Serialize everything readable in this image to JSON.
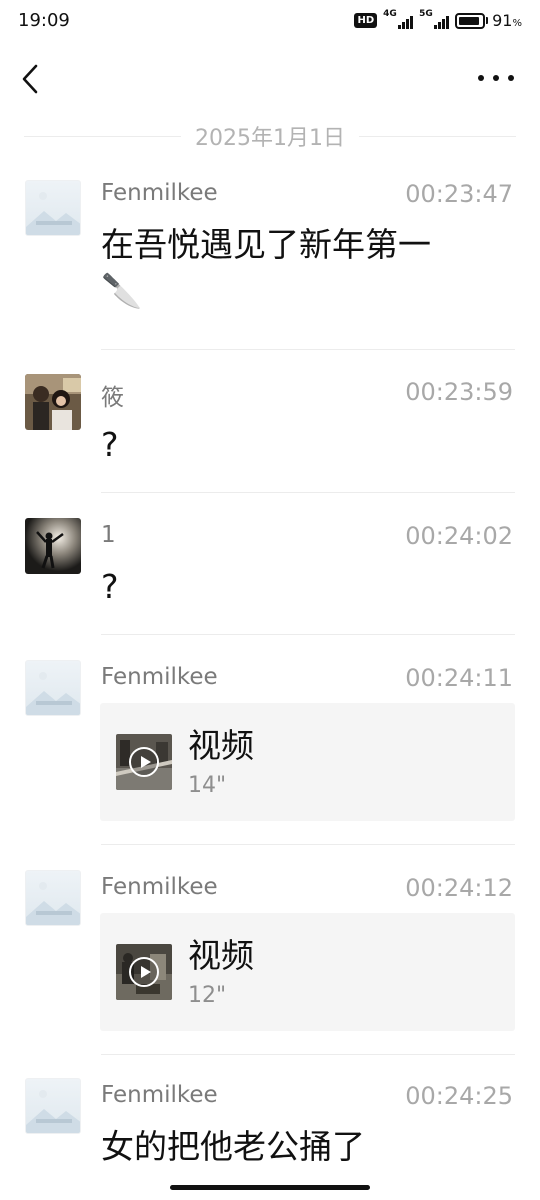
{
  "status_bar": {
    "time": "19:09",
    "hd_label": "HD",
    "net1_label": "4G",
    "net2_label": "5G",
    "battery_percent": "91",
    "battery_unit": "%",
    "battery_level": 0.91
  },
  "nav": {
    "back_icon": "chevron-left-icon",
    "more_icon": "more-horizontal-icon"
  },
  "date_separator": "2025年1月1日",
  "messages": [
    {
      "sender": "Fenmilkee",
      "time": "00:23:47",
      "text": "在吾悦遇见了新年第一",
      "emoji": "🔪",
      "avatar": "default-avatar"
    },
    {
      "sender": "筱",
      "time": "00:23:59",
      "text": "?",
      "avatar": "photo-avatar-couple"
    },
    {
      "sender": "1",
      "time": "00:24:02",
      "text": "?",
      "avatar": "photo-avatar-silhouette"
    },
    {
      "sender": "Fenmilkee",
      "time": "00:24:11",
      "video": {
        "label": "视频",
        "duration": "14\""
      },
      "avatar": "default-avatar"
    },
    {
      "sender": "Fenmilkee",
      "time": "00:24:12",
      "video": {
        "label": "视频",
        "duration": "12\""
      },
      "avatar": "default-avatar"
    },
    {
      "sender": "Fenmilkee",
      "time": "00:24:25",
      "text": "女的把他老公捅了",
      "avatar": "default-avatar"
    }
  ]
}
